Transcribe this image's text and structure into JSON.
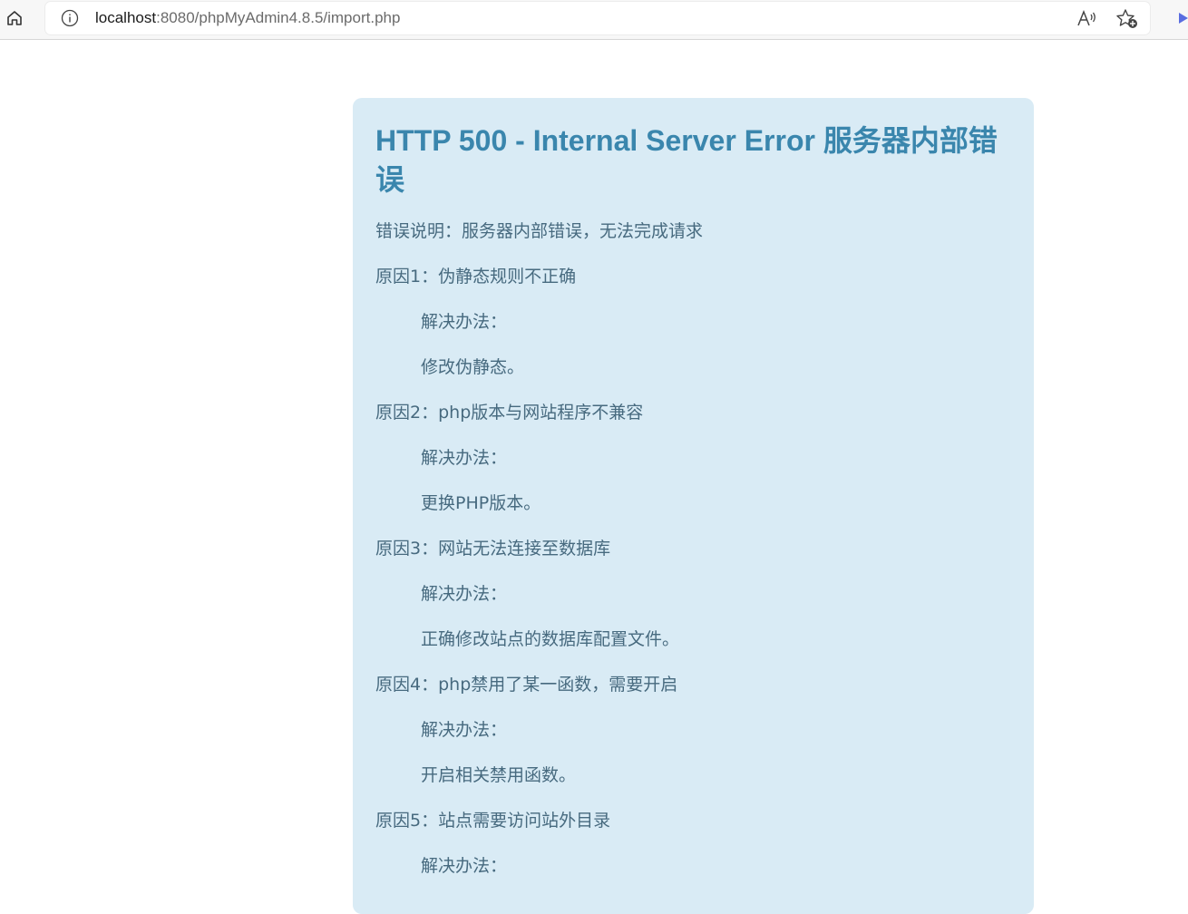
{
  "browser": {
    "url_host": "localhost",
    "url_rest": ":8080/phpMyAdmin4.8.5/import.php",
    "home_icon": "home-icon",
    "info_icon": "info-icon",
    "read_aloud_icon": "read-aloud-icon",
    "favorite_icon": "add-favorite-icon"
  },
  "error": {
    "title": "HTTP 500 - Internal Server Error 服务器内部错误",
    "lines": [
      "错误说明：服务器内部错误，无法完成请求",
      "原因1：伪静态规则不正确",
      "解决办法：",
      "修改伪静态。",
      "原因2：php版本与网站程序不兼容",
      "解决办法：",
      "更换PHP版本。",
      "原因3：网站无法连接至数据库",
      "解决办法：",
      "正确修改站点的数据库配置文件。",
      "原因4：php禁用了某一函数，需要开启",
      "解决办法：",
      "开启相关禁用函数。",
      "原因5：站点需要访问站外目录",
      "解决办法："
    ]
  },
  "colors": {
    "panel_bg": "#d9ebf5",
    "title": "#3a86ad",
    "text": "#476a7f"
  }
}
